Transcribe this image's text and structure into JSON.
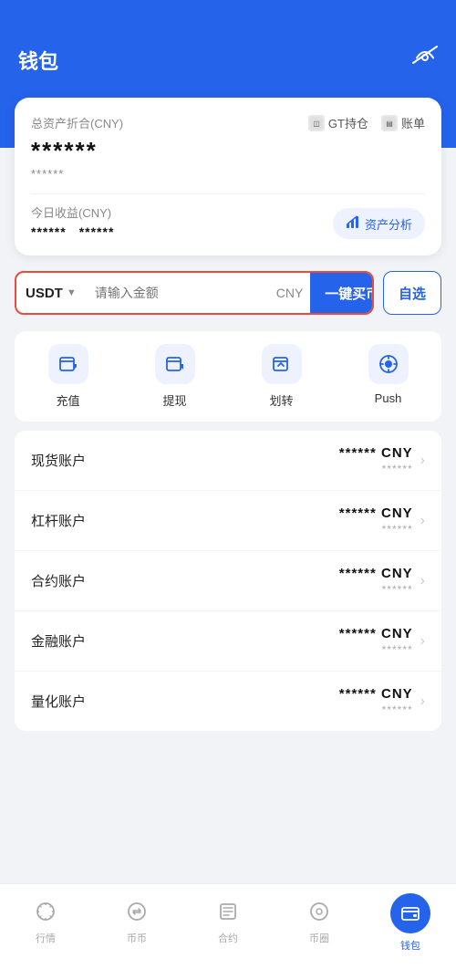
{
  "header": {
    "title": "钱包",
    "eye_icon": "👁"
  },
  "summary_card": {
    "total_label": "总资产折合(CNY)",
    "gt_label": "GT持仓",
    "account_label": "账单",
    "main_value": "******",
    "sub_value": "******",
    "today_income_label": "今日收益(CNY)",
    "income_value1": "******",
    "income_value2": "******",
    "analysis_label": "资产分析"
  },
  "buy_bar": {
    "currency": "USDT",
    "placeholder": "请输入金额",
    "cny_label": "CNY",
    "buy_label": "一键买币",
    "self_select_label": "自选"
  },
  "actions": [
    {
      "icon": "充",
      "label": "充值",
      "symbol": "↓"
    },
    {
      "icon": "提",
      "label": "提现",
      "symbol": "↑"
    },
    {
      "icon": "划",
      "label": "划转",
      "symbol": "⇄"
    },
    {
      "icon": "P",
      "label": "Push",
      "symbol": "⊙"
    }
  ],
  "accounts": [
    {
      "name": "现货账户",
      "main": "****** CNY",
      "sub": "******"
    },
    {
      "name": "杠杆账户",
      "main": "****** CNY",
      "sub": "******"
    },
    {
      "name": "合约账户",
      "main": "****** CNY",
      "sub": "******"
    },
    {
      "name": "金融账户",
      "main": "****** CNY",
      "sub": "******"
    },
    {
      "name": "量化账户",
      "main": "****** CNY",
      "sub": "******"
    }
  ],
  "bottom_nav": [
    {
      "label": "行情",
      "icon": "◷",
      "active": false
    },
    {
      "label": "币币",
      "icon": "⇄",
      "active": false
    },
    {
      "label": "合约",
      "icon": "▤",
      "active": false
    },
    {
      "label": "币圈",
      "icon": "◎",
      "active": false
    },
    {
      "label": "钱包",
      "icon": "◫",
      "active": true
    }
  ]
}
